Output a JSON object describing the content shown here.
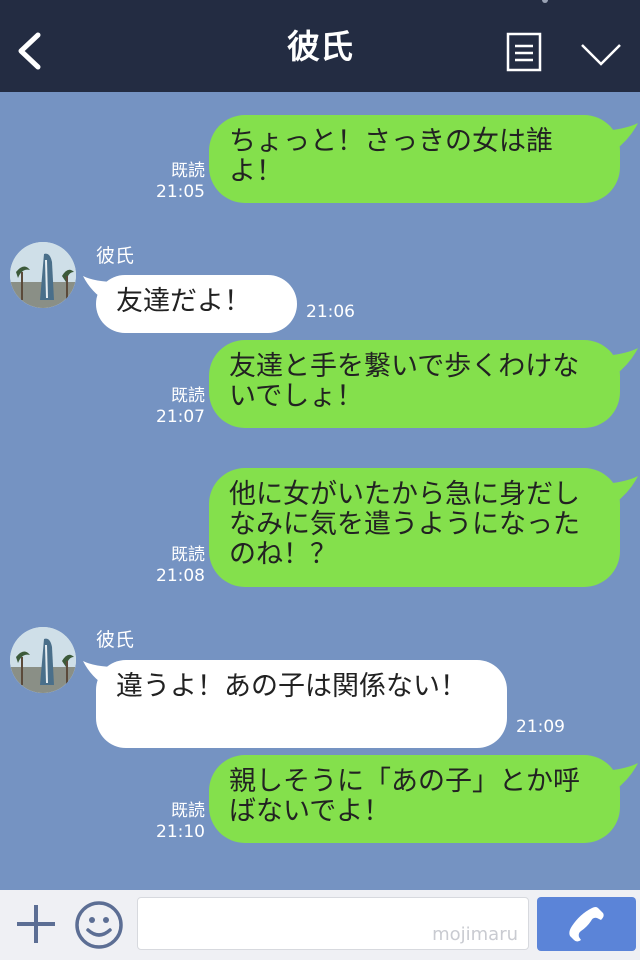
{
  "header": {
    "title": "彼氏"
  },
  "contact": {
    "name": "彼氏"
  },
  "messages": [
    {
      "from": "me",
      "text": "ちょっと！さっきの女は誰よ！",
      "read": "既読",
      "time": "21:05"
    },
    {
      "from": "them",
      "text": "友達だよ！",
      "time": "21:06"
    },
    {
      "from": "me",
      "text": "友達と手を繋いで歩くわけないでしょ！",
      "read": "既読",
      "time": "21:07"
    },
    {
      "from": "me",
      "text": "他に女がいたから急に身だしなみに気を遣うようになったのね！？",
      "read": "既読",
      "time": "21:08"
    },
    {
      "from": "them",
      "text": "違うよ！あの子は関係ない！",
      "time": "21:09"
    },
    {
      "from": "me",
      "text": "親しそうに「あの子」とか呼ばないでよ！",
      "read": "既読",
      "time": "21:10"
    }
  ],
  "footer": {
    "input_placeholder": "",
    "watermark": "mojimaru"
  },
  "colors": {
    "background": "#7593c2",
    "header": "#232c42",
    "my_bubble": "#84e04c",
    "their_bubble": "#ffffff",
    "call_button": "#5b84d8"
  },
  "icons": {
    "back": "chevron-left-icon",
    "notes": "note-icon",
    "menu": "chevron-down-icon",
    "plus": "plus-icon",
    "emoji": "smiley-icon",
    "call": "phone-icon"
  }
}
